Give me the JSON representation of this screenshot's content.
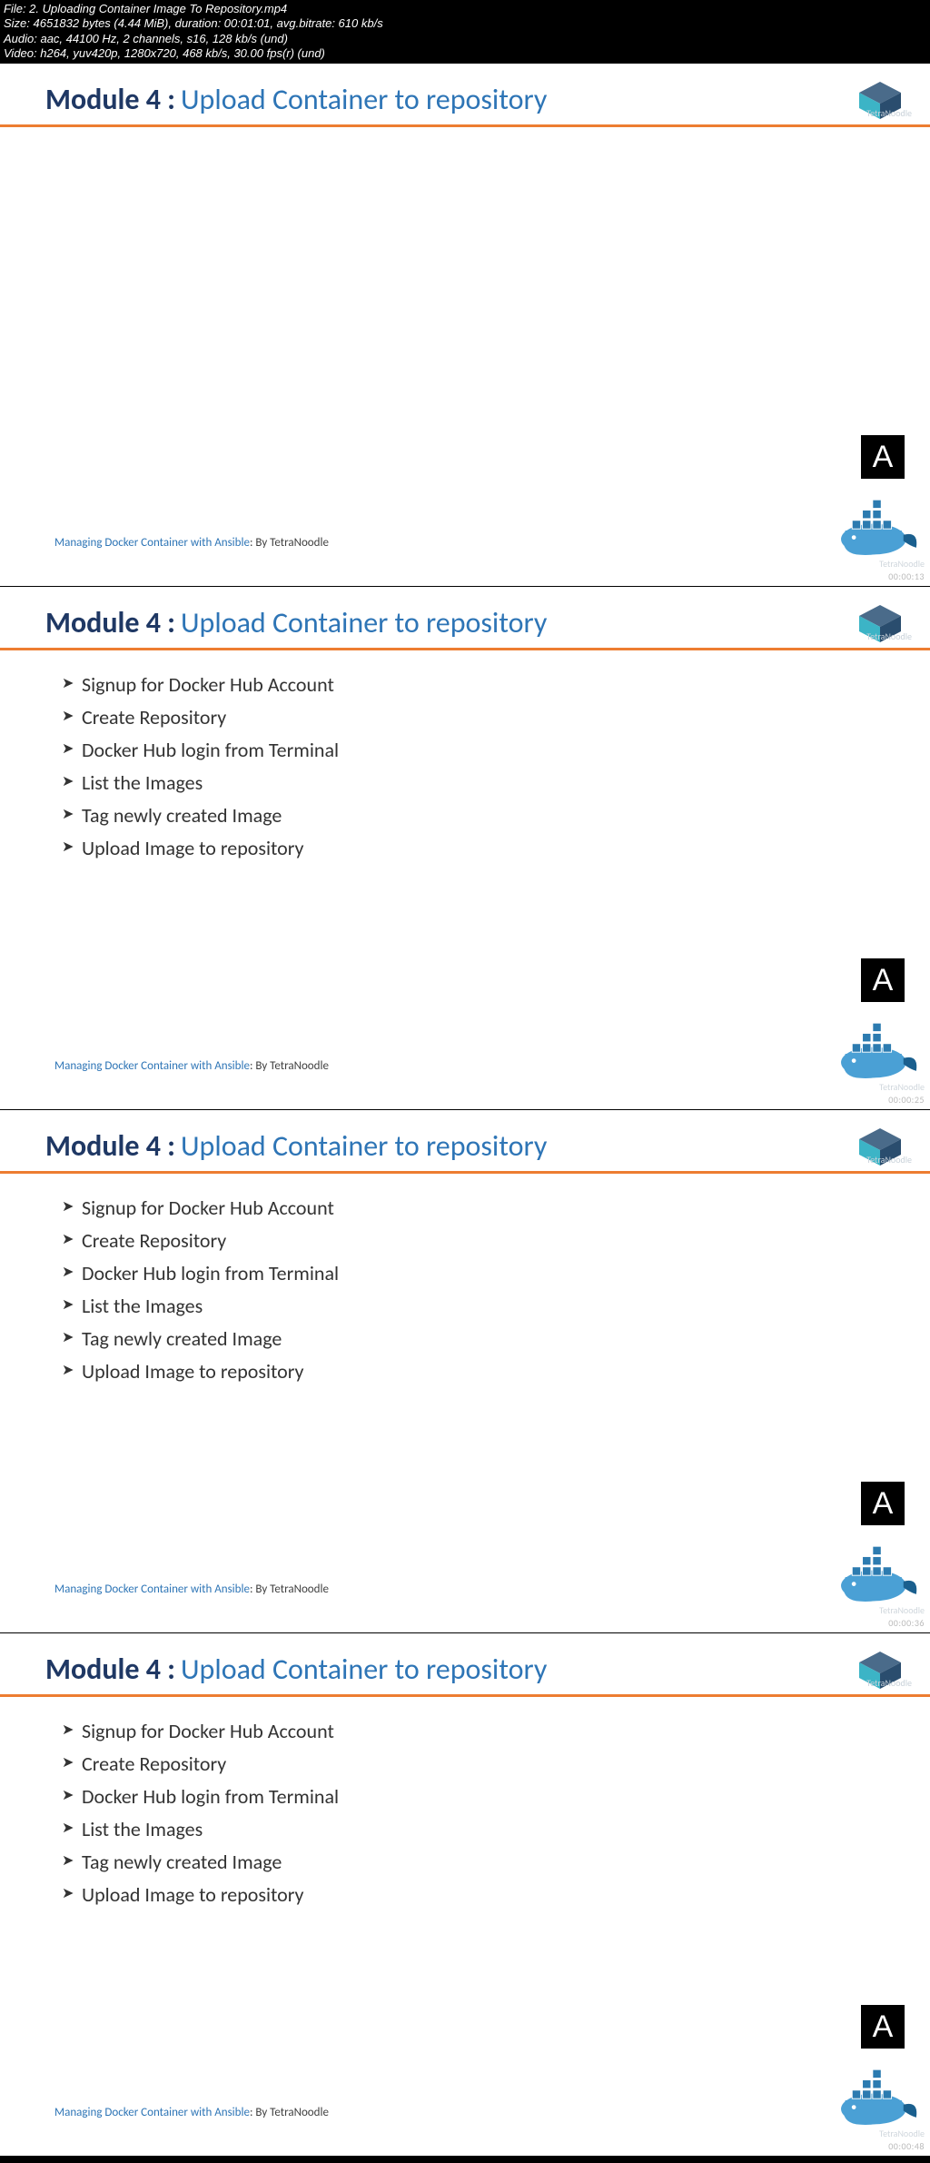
{
  "media": {
    "file": "File: 2. Uploading Container Image To Repository.mp4",
    "size": "Size: 4651832 bytes (4.44 MiB), duration: 00:01:01, avg.bitrate: 610 kb/s",
    "audio": "Audio: aac, 44100 Hz, 2 channels, s16, 128 kb/s (und)",
    "video": "Video: h264, yuv420p, 1280x720, 468 kb/s, 30.00 fps(r) (und)"
  },
  "slide_header": {
    "module_label": "Module 4 :",
    "title": "Upload Container to repository",
    "watermark": "TetraNoodle"
  },
  "bullets": [
    "Signup for Docker Hub Account",
    "Create Repository",
    "Docker Hub login from Terminal",
    "List the Images",
    "Tag newly created Image",
    "Upload Image to repository"
  ],
  "footer": {
    "link": "Managing Docker Container with Ansible",
    "by": ": By TetraNoodle"
  },
  "timestamps": [
    "00:00:13",
    "00:00:25",
    "00:00:36",
    "00:00:48"
  ],
  "icons": {
    "ansible_letter": "A"
  }
}
